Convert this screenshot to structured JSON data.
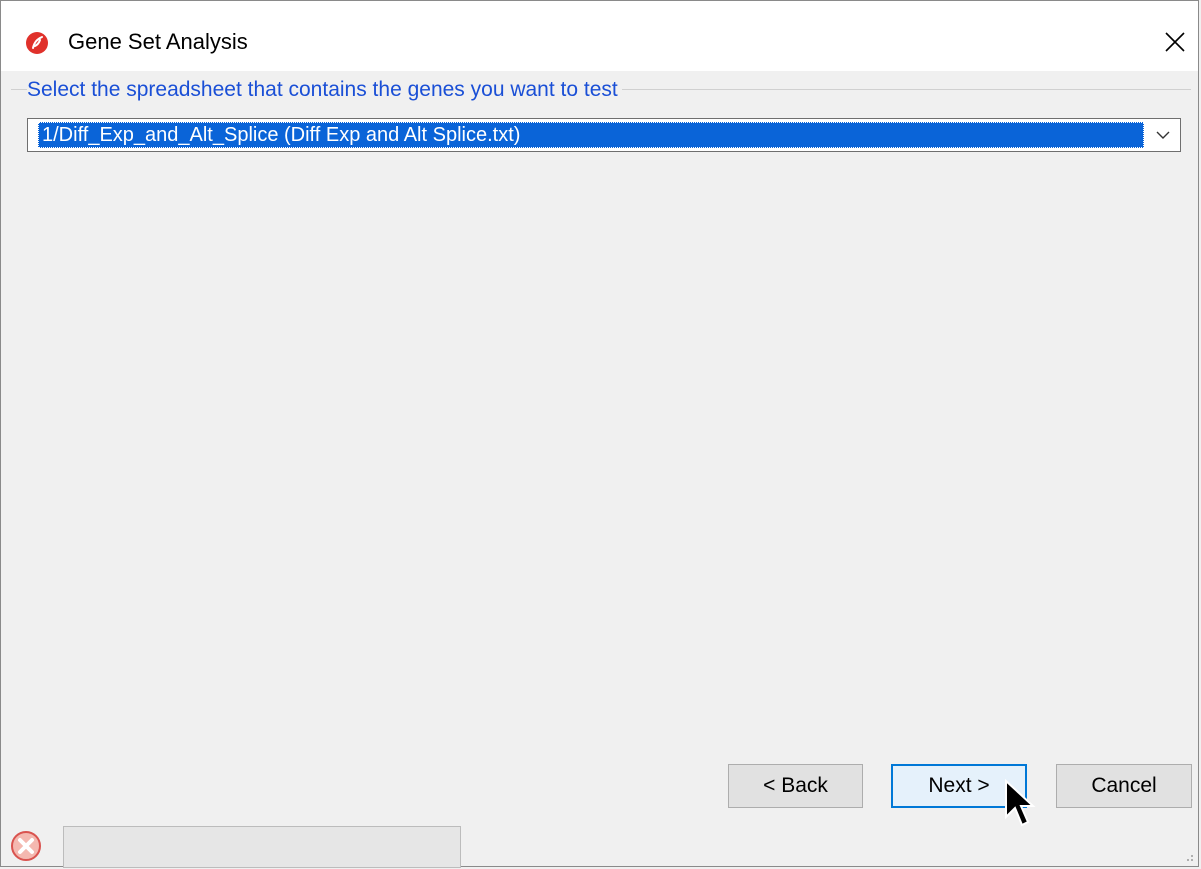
{
  "window": {
    "title": "Gene Set Analysis",
    "close_label": "×"
  },
  "selection_group": {
    "label": "Select the spreadsheet that contains the genes you want to test",
    "selected_value": "1/Diff_Exp_and_Alt_Splice (Diff Exp and Alt Splice.txt)"
  },
  "buttons": {
    "back": "< Back",
    "next": "Next >",
    "cancel": "Cancel"
  },
  "icons": {
    "app": "app-logo-icon",
    "close": "close-icon",
    "dropdown": "chevron-down-icon",
    "status": "error-status-icon",
    "cursor": "mouse-cursor-icon",
    "grip": "resize-grip-icon"
  },
  "colors": {
    "accent": "#0a64d8",
    "label_blue": "#1a4fd6",
    "app_icon_red": "#e0312b"
  }
}
